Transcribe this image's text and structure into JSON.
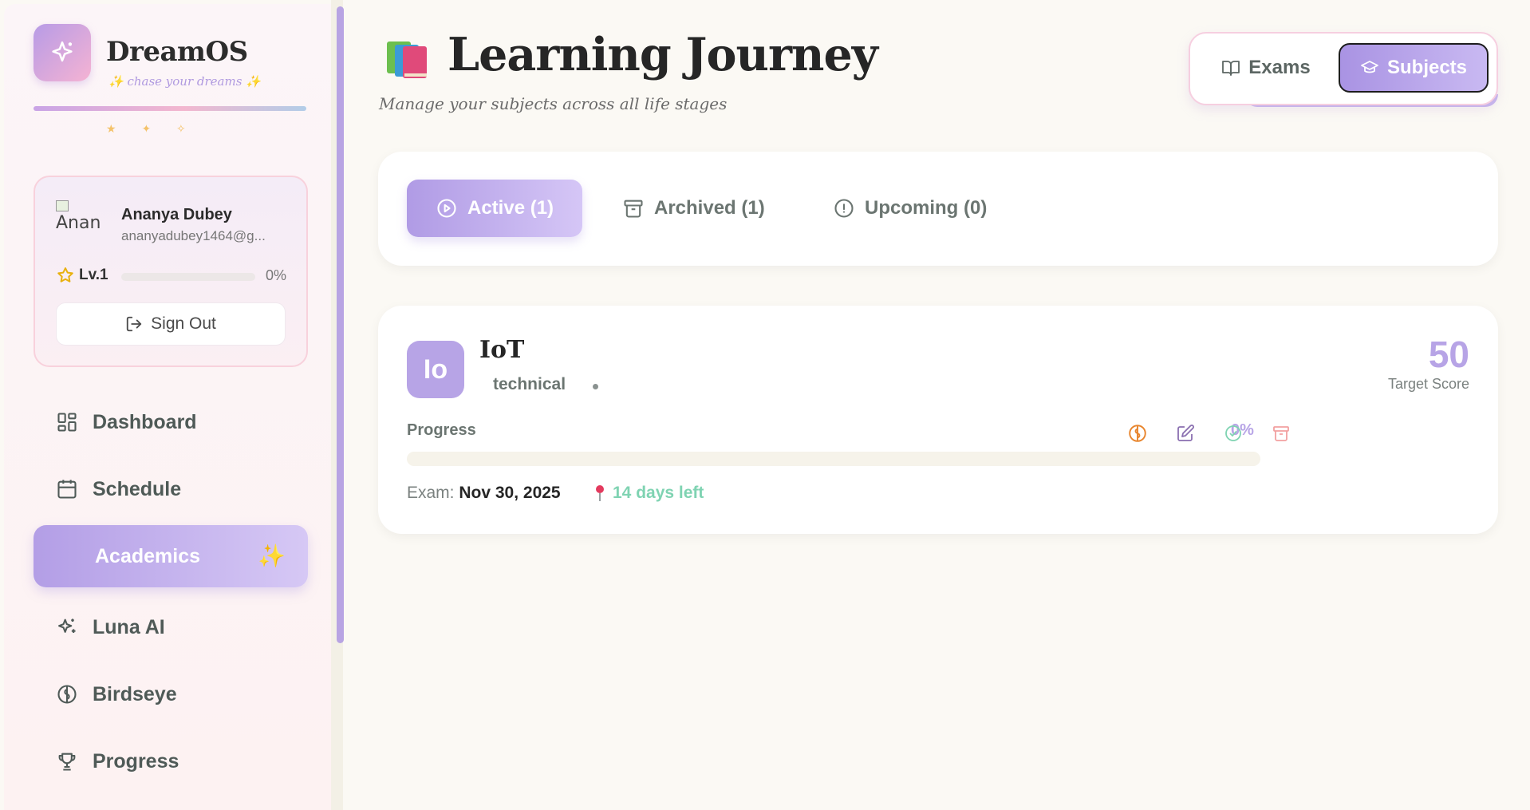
{
  "sidebar": {
    "brand": "DreamOS",
    "tagline": "✨ chase your dreams ✨",
    "sparkles": "★ ✦ ✧",
    "user": {
      "avatar_alt": "Anan",
      "name": "Ananya Dubey",
      "email": "ananyadubey1464@g...",
      "level": "Lv.1",
      "level_progress": 0,
      "level_pct": "0%"
    },
    "signout_label": "Sign Out",
    "nav": [
      {
        "label": "Dashboard",
        "icon": "layout-grid-icon"
      },
      {
        "label": "Schedule",
        "icon": "calendar-icon"
      },
      {
        "label": "Academics",
        "icon": "graduation-cap-icon",
        "active": true,
        "badge": "✨"
      },
      {
        "label": "Luna AI",
        "icon": "sparkles-icon"
      },
      {
        "label": "Birdseye",
        "icon": "brain-icon"
      },
      {
        "label": "Progress",
        "icon": "trophy-icon"
      }
    ]
  },
  "header": {
    "title": "Learning Journey",
    "emoji": "📚",
    "subtitle": "Manage your subjects across all life stages",
    "toggle": {
      "exams": "Exams",
      "subjects": "Subjects",
      "selected": "Subjects"
    }
  },
  "filters": [
    {
      "label": "Active (1)",
      "active": true
    },
    {
      "label": "Archived (1)"
    },
    {
      "label": "Upcoming (0)"
    }
  ],
  "subjects": [
    {
      "initials": "Io",
      "name": "IoT",
      "category": "technical",
      "target_score": "50",
      "target_label": "Target Score",
      "progress_label": "Progress",
      "progress_value": 0,
      "progress_pct": "0%",
      "exam_prefix": "Exam:",
      "exam_date": "Nov 30, 2025",
      "days_left": "14 days left"
    }
  ],
  "colors": {
    "accent": "#b7a4e6",
    "success": "#7fd3b2",
    "brain_icon": "#e8862f",
    "edit_icon": "#8a6fb0",
    "check_icon": "#7fd3b2",
    "archive_icon": "#f2a0a0"
  }
}
